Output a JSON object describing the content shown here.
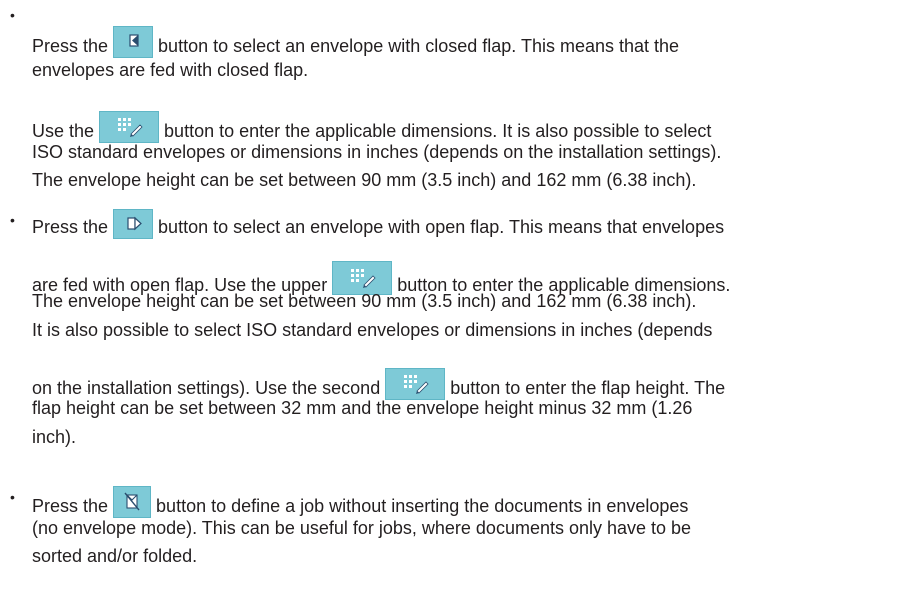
{
  "bullets": [
    "•",
    "•",
    "•",
    "•"
  ],
  "icons": {
    "closed_flap": "envelope-closed-flap-icon",
    "keypad": "keypad-edit-icon",
    "open_flap": "envelope-open-flap-icon",
    "no_envelope": "no-envelope-icon"
  },
  "colors": {
    "button_bg": "#7ecad7",
    "text": "#231f20"
  },
  "p1": {
    "l1a": "Press the",
    "l1b": "button to select an envelope with closed flap. This means that the",
    "l2": "envelopes are fed with closed flap."
  },
  "p2": {
    "l1a": "Use the",
    "l1b": "button to enter the applicable dimensions. It is also possible to select",
    "l2": "ISO standard envelopes or dimensions in inches (depends on the installation settings).",
    "l3": "The envelope height can be set between 90 mm (3.5 inch) and 162 mm (6.38 inch)."
  },
  "p3": {
    "l1a": "Press the",
    "l1b": "button to select an envelope with open flap. This means that envelopes",
    "l2a": "are fed with open flap. Use the upper",
    "l2b": "button to enter the applicable dimensions.",
    "l3": "The envelope height can be set between 90 mm (3.5 inch) and 162 mm (6.38 inch).",
    "l4": "It is also possible to select ISO standard envelopes or dimensions in inches (depends",
    "l5a": "on the installation settings). Use the second",
    "l5b": "button to enter the flap height. The",
    "l6": "flap height can be set between 32 mm and the envelope height minus 32 mm (1.26",
    "l7": "inch)."
  },
  "p4": {
    "l1a": "Press the",
    "l1b": "button to define a job without inserting the documents in envelopes",
    "l2": "(no envelope mode). This can be useful for jobs, where documents only have to be",
    "l3": "sorted and/or folded."
  }
}
